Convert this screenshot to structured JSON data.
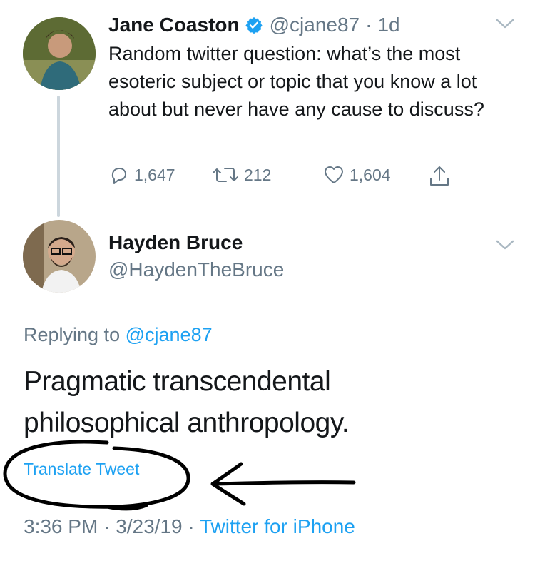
{
  "tweet1": {
    "name": "Jane Coaston",
    "handle": "@cjane87",
    "separator": "·",
    "time": "1d",
    "text": "Random twitter question: what’s the most esoteric subject or topic that you know a lot about but never have any cause to discuss?",
    "replies": "1,647",
    "retweets": "212",
    "likes": "1,604"
  },
  "tweet2": {
    "name": "Hayden Bruce",
    "handle": "@HaydenTheBruce",
    "replying_prefix": "Replying to",
    "replying_to": "@cjane87",
    "text": "Pragmatic transcendental philosophical anthropology.",
    "translate": "Translate Tweet",
    "timestamp": "3:36 PM",
    "date": "3/23/19",
    "dot1": "·",
    "dot2": "·",
    "source": "Twitter for iPhone"
  },
  "colors": {
    "accent": "#1da1f2",
    "muted": "#657786",
    "thread_line": "#ccd6dd"
  }
}
